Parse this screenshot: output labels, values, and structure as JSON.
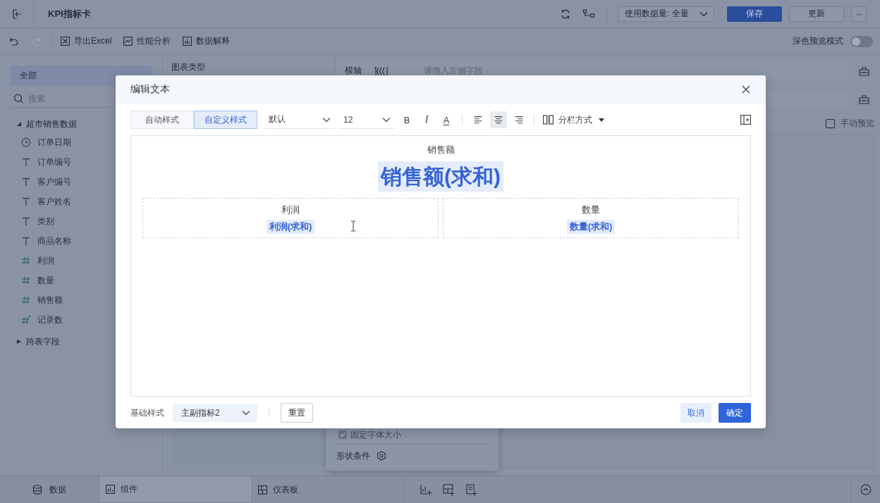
{
  "header": {
    "title": "KPI指标卡",
    "data_scope": {
      "label": "使用数据量:",
      "value": "全量"
    },
    "buttons": [
      {
        "label": "保存",
        "kind": "primary"
      },
      {
        "label": "更新",
        "kind": "default"
      },
      {
        "label": "···",
        "kind": "more"
      }
    ]
  },
  "toolbar": {
    "history": [
      {
        "kind": "undo",
        "disabled": false
      },
      {
        "kind": "redo",
        "disabled": true
      }
    ],
    "actions": [
      {
        "label": "导出Excel",
        "kind": "excel"
      },
      {
        "label": "性能分析",
        "kind": "performance"
      },
      {
        "label": "数据解释",
        "kind": "explain"
      }
    ],
    "dark_preview": {
      "label": "深色预览模式",
      "on": false
    }
  },
  "field_panel": {
    "source": "全部",
    "search": {
      "placeholder": "搜索"
    },
    "tree": [
      {
        "label": "超市销售数据",
        "expanded": true,
        "children": [
          {
            "label": "订单日期",
            "kind": "date"
          },
          {
            "label": "订单编号",
            "kind": "text"
          },
          {
            "label": "客户编号",
            "kind": "text"
          },
          {
            "label": "客户姓名",
            "kind": "text"
          },
          {
            "label": "类别",
            "kind": "text"
          },
          {
            "label": "商品名称",
            "kind": "text"
          },
          {
            "label": "利润",
            "kind": "number"
          },
          {
            "label": "数量",
            "kind": "number"
          },
          {
            "label": "销售额",
            "kind": "number"
          },
          {
            "label": "记录数",
            "kind": "count"
          }
        ]
      },
      {
        "label": "跨表字段",
        "expanded": false
      }
    ]
  },
  "chart_type": {
    "title": "图表类型"
  },
  "shelves": [
    {
      "label": "横轴",
      "placeholder": "请拖入左侧字段"
    }
  ],
  "manual_preview": {
    "label": "手动预览",
    "checked": false
  },
  "style_panel": {
    "items": [
      {
        "kind": "checkbox",
        "label": "固定字体大小",
        "checked": true
      },
      {
        "kind": "setting",
        "label": "形状条件"
      }
    ]
  },
  "bottom_tabs": [
    {
      "label": "数据",
      "kind": "data",
      "selected": false
    },
    {
      "label": "组件",
      "kind": "component",
      "selected": true
    },
    {
      "label": "仪表板",
      "kind": "dashboard",
      "selected": false
    }
  ],
  "dialog": {
    "title": "编辑文本",
    "style_modes": [
      {
        "label": "自动样式",
        "selected": false
      },
      {
        "label": "自定义样式",
        "selected": true
      }
    ],
    "font_family": "默认",
    "font_size": "12",
    "formats": [
      {
        "kind": "bold",
        "glyph": "B"
      },
      {
        "kind": "italic",
        "glyph": "I"
      },
      {
        "kind": "color",
        "glyph": "A"
      }
    ],
    "align": [
      {
        "kind": "left",
        "selected": false
      },
      {
        "kind": "center",
        "selected": true
      },
      {
        "kind": "right",
        "selected": false
      }
    ],
    "column_mode": "分栏方式",
    "content": {
      "title": "销售额",
      "value": "销售额(求和)",
      "subs": [
        {
          "title": "利润",
          "value": "利润(求和)"
        },
        {
          "title": "数量",
          "value": "数量(求和)"
        }
      ]
    },
    "footer": {
      "base_style": {
        "label": "基础样式",
        "value": "主副指标2"
      },
      "buttons": [
        {
          "label": "重置",
          "kind": "reset"
        },
        {
          "label": "取消",
          "kind": "cancel"
        },
        {
          "label": "确定",
          "kind": "confirm"
        }
      ]
    }
  }
}
